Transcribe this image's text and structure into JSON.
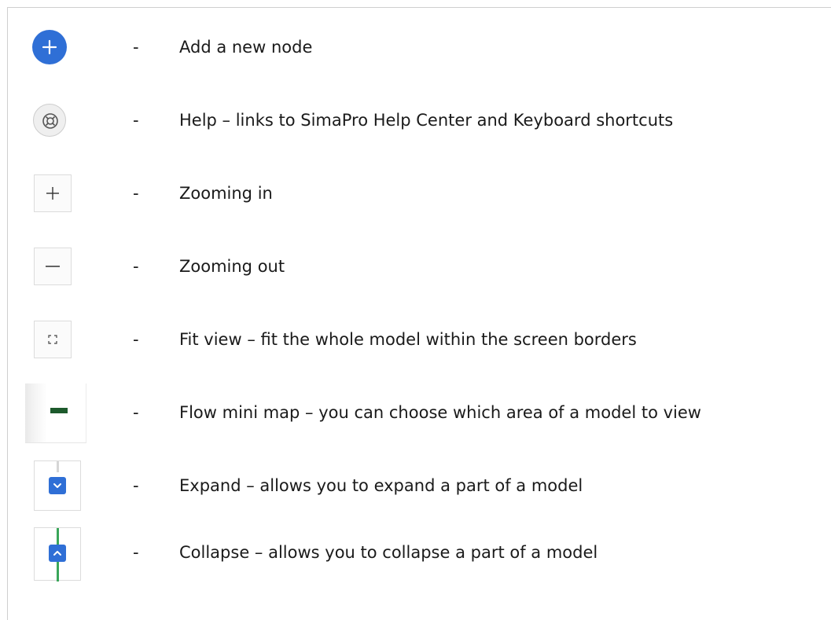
{
  "colors": {
    "accent_blue": "#2f6fd6",
    "minimap_node": "#1d5a2c",
    "collapse_line": "#3aa65a",
    "expand_line": "#d6d6d6"
  },
  "items": [
    {
      "icon": "add-node-icon",
      "dash": "-",
      "label": "Add a new node"
    },
    {
      "icon": "help-lifebuoy-icon",
      "dash": "-",
      "label": "Help – links to SimaPro Help Center and Keyboard shortcuts"
    },
    {
      "icon": "plus-icon",
      "dash": "-",
      "label": "Zooming in"
    },
    {
      "icon": "minus-icon",
      "dash": "-",
      "label": "Zooming out"
    },
    {
      "icon": "fit-view-icon",
      "dash": "-",
      "label": "Fit view – fit the whole model within the screen borders"
    },
    {
      "icon": "mini-map-icon",
      "dash": "-",
      "label": "Flow mini map – you can choose which area of a model to view"
    },
    {
      "icon": "chevron-down-icon",
      "dash": "-",
      "label": "Expand – allows you to expand a part of a model"
    },
    {
      "icon": "chevron-up-icon",
      "dash": "-",
      "label": "Collapse – allows you to collapse a part of a model"
    }
  ]
}
